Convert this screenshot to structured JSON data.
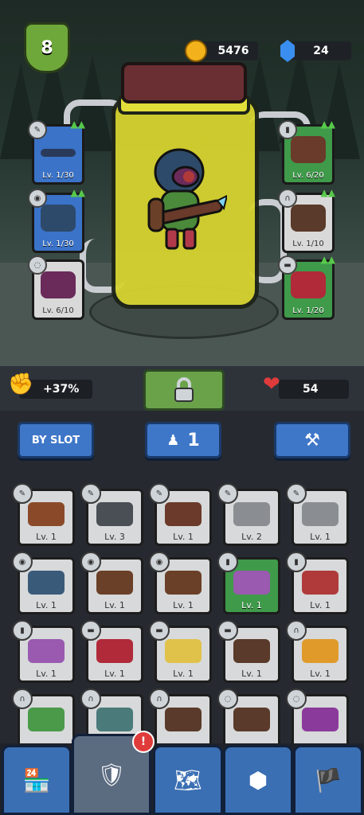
{
  "player": {
    "level": "8"
  },
  "currency": {
    "coins": "5476",
    "gems": "24",
    "coin_icon": "gold-coin-icon",
    "gem_icon": "blue-gem-icon"
  },
  "equipped_left": [
    {
      "level": "Lv. 1/30",
      "slot": "weapon",
      "rarity": "blue",
      "upgradable": true
    },
    {
      "level": "Lv. 1/30",
      "slot": "hat",
      "rarity": "blue",
      "upgradable": true
    },
    {
      "level": "Lv. 6/10",
      "slot": "mask",
      "rarity": "grey",
      "upgradable": false
    }
  ],
  "equipped_right": [
    {
      "level": "Lv. 6/20",
      "slot": "shirt",
      "rarity": "green",
      "upgradable": true
    },
    {
      "level": "Lv. 1/10",
      "slot": "pants",
      "rarity": "grey",
      "upgradable": true
    },
    {
      "level": "Lv. 1/20",
      "slot": "boots",
      "rarity": "green",
      "upgradable": true
    }
  ],
  "stats": {
    "attack_bonus": "+37%",
    "health": "54"
  },
  "controls": {
    "sort_label": "BY SLOT",
    "loadout_count": "1"
  },
  "inventory": [
    {
      "level": "Lv. 1",
      "slot": "weapon",
      "color": "#8a4a2a",
      "rarity": "grey"
    },
    {
      "level": "Lv. 3",
      "slot": "weapon",
      "color": "#4a4f55",
      "rarity": "grey"
    },
    {
      "level": "Lv. 1",
      "slot": "weapon",
      "color": "#6b3a2a",
      "rarity": "grey"
    },
    {
      "level": "Lv. 2",
      "slot": "weapon",
      "color": "#8a8e92",
      "rarity": "grey"
    },
    {
      "level": "Lv. 1",
      "slot": "weapon",
      "color": "#8a8e92",
      "rarity": "grey"
    },
    {
      "level": "Lv. 1",
      "slot": "hat",
      "color": "#3a5a7a",
      "rarity": "grey"
    },
    {
      "level": "Lv. 1",
      "slot": "hat",
      "color": "#6b4028",
      "rarity": "grey"
    },
    {
      "level": "Lv. 1",
      "slot": "hat",
      "color": "#6b4028",
      "rarity": "grey"
    },
    {
      "level": "Lv. 1",
      "slot": "shirt",
      "color": "#9a5ab0",
      "rarity": "green"
    },
    {
      "level": "Lv. 1",
      "slot": "shirt",
      "color": "#b03a3a",
      "rarity": "grey"
    },
    {
      "level": "Lv. 1",
      "slot": "shirt",
      "color": "#9a5ab0",
      "rarity": "grey"
    },
    {
      "level": "Lv. 1",
      "slot": "boots",
      "color": "#b02a3a",
      "rarity": "grey"
    },
    {
      "level": "Lv. 1",
      "slot": "boots",
      "color": "#e0c24a",
      "rarity": "grey"
    },
    {
      "level": "Lv. 1",
      "slot": "boots",
      "color": "#5a3a2a",
      "rarity": "grey"
    },
    {
      "level": "Lv. 1",
      "slot": "pants",
      "color": "#e09a2a",
      "rarity": "grey"
    },
    {
      "level": "",
      "slot": "pants",
      "color": "#4a9a4a",
      "rarity": "grey"
    },
    {
      "level": "",
      "slot": "pants",
      "color": "#4a7a7a",
      "rarity": "grey"
    },
    {
      "level": "",
      "slot": "pants",
      "color": "#5a3a2a",
      "rarity": "grey"
    },
    {
      "level": "",
      "slot": "mask",
      "color": "#5a3a2a",
      "rarity": "grey"
    },
    {
      "level": "",
      "slot": "mask",
      "color": "#8a3a9a",
      "rarity": "grey"
    }
  ],
  "nav": [
    {
      "icon": "shop-icon"
    },
    {
      "icon": "armor-icon",
      "badge": "!"
    },
    {
      "icon": "map-icon"
    },
    {
      "icon": "skills-hex-icon"
    },
    {
      "icon": "banner-icon"
    }
  ],
  "colors": {
    "accent_blue": "#3f77c8",
    "accent_green": "#6aa24a",
    "alert_red": "#e03b3b"
  }
}
